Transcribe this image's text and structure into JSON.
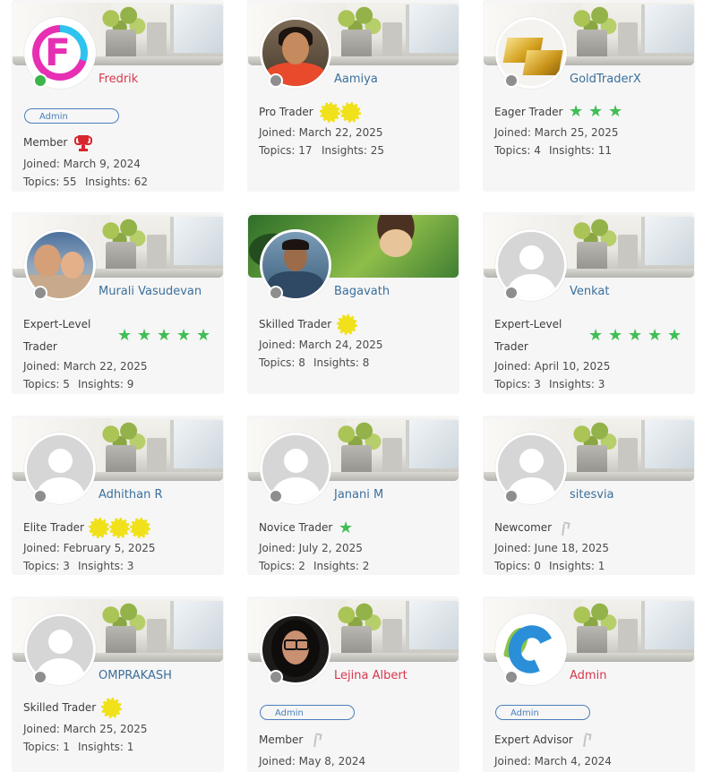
{
  "members": [
    {
      "name": "Fredrik",
      "name_color": "red",
      "avatar": "fredrik-logo",
      "status": "online",
      "cover": "office",
      "admin": "Admin",
      "rank": "Member",
      "rank_icon": "trophy-icon",
      "rank_icon_count": 1,
      "joined": "Joined: March 9, 2024",
      "topics": "Topics: 55",
      "insights": "Insights: 62"
    },
    {
      "name": "Aamiya",
      "name_color": "blue",
      "avatar": "photo-woman",
      "status": "offline",
      "cover": "office",
      "rank": "Pro Trader",
      "rank_icon": "sun-badge-icon",
      "rank_icon_count": 2,
      "joined": "Joined: March 22, 2025",
      "topics": "Topics: 17",
      "insights": "Insights: 25"
    },
    {
      "name": "GoldTraderX",
      "name_color": "blue",
      "avatar": "gold-bars",
      "status": "offline",
      "cover": "office",
      "rank": "Eager Trader",
      "rank_icon": "star-icon",
      "rank_icon_count": 3,
      "joined": "Joined: March 25, 2025",
      "topics": "Topics: 4",
      "insights": "Insights: 11"
    },
    {
      "name": "Murali Vasudevan",
      "name_color": "blue",
      "avatar": "photo-family",
      "status": "offline",
      "cover": "office",
      "rank": "Expert-Level Trader",
      "rank_icon": "star-icon",
      "rank_icon_count": 5,
      "joined": "Joined: March 22, 2025",
      "topics": "Topics: 5",
      "insights": "Insights: 9"
    },
    {
      "name": "Bagavath",
      "name_color": "blue",
      "avatar": "photo-man",
      "status": "offline",
      "cover": "game-art",
      "rank": "Skilled Trader",
      "rank_icon": "sun-badge-icon",
      "rank_icon_count": 1,
      "joined": "Joined: March 24, 2025",
      "topics": "Topics: 8",
      "insights": "Insights: 8"
    },
    {
      "name": "Venkat",
      "name_color": "blue",
      "avatar": "generic",
      "status": "offline",
      "cover": "office",
      "rank": "Expert-Level Trader",
      "rank_icon": "star-icon",
      "rank_icon_count": 5,
      "joined": "Joined: April 10, 2025",
      "topics": "Topics: 3",
      "insights": "Insights: 3"
    },
    {
      "name": "Adhithan R",
      "name_color": "blue",
      "avatar": "generic",
      "status": "offline",
      "cover": "office",
      "rank": "Elite Trader",
      "rank_icon": "sun-badge-icon",
      "rank_icon_count": 3,
      "joined": "Joined: February 5, 2025",
      "topics": "Topics: 3",
      "insights": "Insights: 3"
    },
    {
      "name": "Janani M",
      "name_color": "blue",
      "avatar": "generic",
      "status": "offline",
      "cover": "office",
      "rank": "Novice Trader",
      "rank_icon": "star-icon",
      "rank_icon_count": 1,
      "joined": "Joined: July 2, 2025",
      "topics": "Topics: 2",
      "insights": "Insights: 2"
    },
    {
      "name": "sitesvia",
      "name_color": "blue",
      "avatar": "generic",
      "status": "offline",
      "cover": "office",
      "rank": "Newcomer",
      "rank_icon": "twig-icon",
      "rank_icon_count": 1,
      "joined": "Joined: June 18, 2025",
      "topics": "Topics: 0",
      "insights": "Insights: 1"
    },
    {
      "name": "OMPRAKASH",
      "name_color": "blue",
      "avatar": "generic",
      "status": "offline",
      "cover": "office",
      "rank": "Skilled Trader",
      "rank_icon": "sun-badge-icon",
      "rank_icon_count": 1,
      "joined": "Joined: March 25, 2025",
      "topics": "Topics: 1",
      "insights": "Insights: 1"
    },
    {
      "name": "Lejina Albert",
      "name_color": "red",
      "avatar": "photo-woman-glasses",
      "status": "offline",
      "cover": "office",
      "admin": "Admin",
      "rank": "Member",
      "rank_icon": "twig-icon",
      "rank_icon_count": 1,
      "joined": "Joined: May 8, 2024"
    },
    {
      "name": "Admin",
      "name_color": "red",
      "avatar": "admin-logo",
      "status": "offline",
      "cover": "office",
      "admin": "Admin",
      "rank": "Expert Advisor",
      "rank_icon": "twig-icon",
      "rank_icon_count": 1,
      "joined": "Joined: March 4, 2024"
    }
  ],
  "colors": {
    "name_blue": "#3b6f9c",
    "name_red": "#d6384d",
    "online": "#3cb549",
    "offline": "#8e8e8e",
    "star": "#3fbe54",
    "sun": "#f0e11a",
    "admin_badge": "#4a7fbd",
    "card_bg": "#f6f6f6"
  }
}
